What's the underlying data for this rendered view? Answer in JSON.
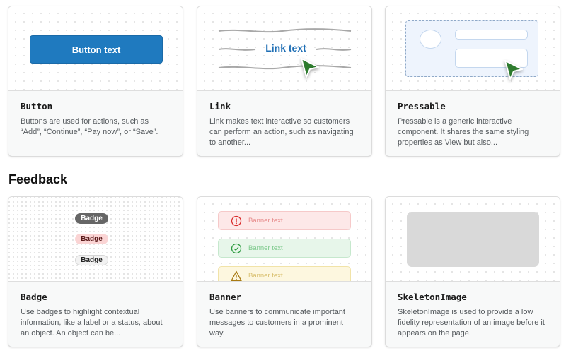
{
  "sections": {
    "feedback": "Feedback"
  },
  "cards": {
    "button": {
      "title": "Button",
      "description": "Buttons are used for actions, such as “Add”, “Continue”, “Pay now”, or “Save”.",
      "preview_label": "Button text",
      "accent": "#1f7abf"
    },
    "link": {
      "title": "Link",
      "description": "Link makes text interactive so customers can perform an action, such as navigating to another...",
      "preview_label": "Link text",
      "accent": "#1f6fb5"
    },
    "pressable": {
      "title": "Pressable",
      "description": "Pressable is a generic interactive component. It shares the same styling properties as View but also..."
    },
    "badge": {
      "title": "Badge",
      "description": "Use badges to highlight contextual information, like a label or a status, about an object. An object can be...",
      "badges": [
        "Badge",
        "Badge",
        "Badge"
      ]
    },
    "banner": {
      "title": "Banner",
      "description": "Use banners to communicate important messages to customers in a prominent way.",
      "banners": [
        {
          "text": "Banner text",
          "icon": "error-circle-icon",
          "color": "#d92b2b"
        },
        {
          "text": "Banner text",
          "icon": "check-circle-icon",
          "color": "#2b9a3e"
        },
        {
          "text": "Banner text",
          "icon": "warning-triangle-icon",
          "color": "#a87a12"
        }
      ]
    },
    "skeleton_image": {
      "title": "SkeletonImage",
      "description": "SkeletonImage is used to provide a low fidelity representation of an image before it appears on the page."
    }
  },
  "cursor_color": "#2d7a2d"
}
